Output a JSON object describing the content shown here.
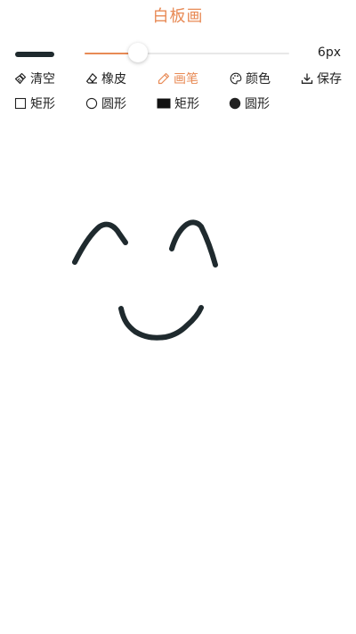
{
  "header": {
    "title": "白板画"
  },
  "stroke": {
    "color": "#1f2a2e",
    "size_label": "6px",
    "slider_fraction": 0.26
  },
  "accent_color": "#e88a55",
  "toolbar": {
    "row1": [
      {
        "id": "clear",
        "label": "清空",
        "icon": "broom-icon",
        "active": false
      },
      {
        "id": "eraser",
        "label": "橡皮",
        "icon": "eraser-icon",
        "active": false
      },
      {
        "id": "brush",
        "label": "画笔",
        "icon": "pencil-icon",
        "active": true
      },
      {
        "id": "color",
        "label": "颜色",
        "icon": "palette-icon",
        "active": false
      },
      {
        "id": "save",
        "label": "保存",
        "icon": "download-icon",
        "active": false
      }
    ],
    "row2": [
      {
        "id": "rect-outline",
        "label": "矩形",
        "icon": "rectangle-outline-icon"
      },
      {
        "id": "circle-outline",
        "label": "圆形",
        "icon": "circle-outline-icon"
      },
      {
        "id": "rect-filled",
        "label": "矩形",
        "icon": "rectangle-filled-icon"
      },
      {
        "id": "circle-filled",
        "label": "圆形",
        "icon": "circle-filled-icon"
      }
    ]
  }
}
